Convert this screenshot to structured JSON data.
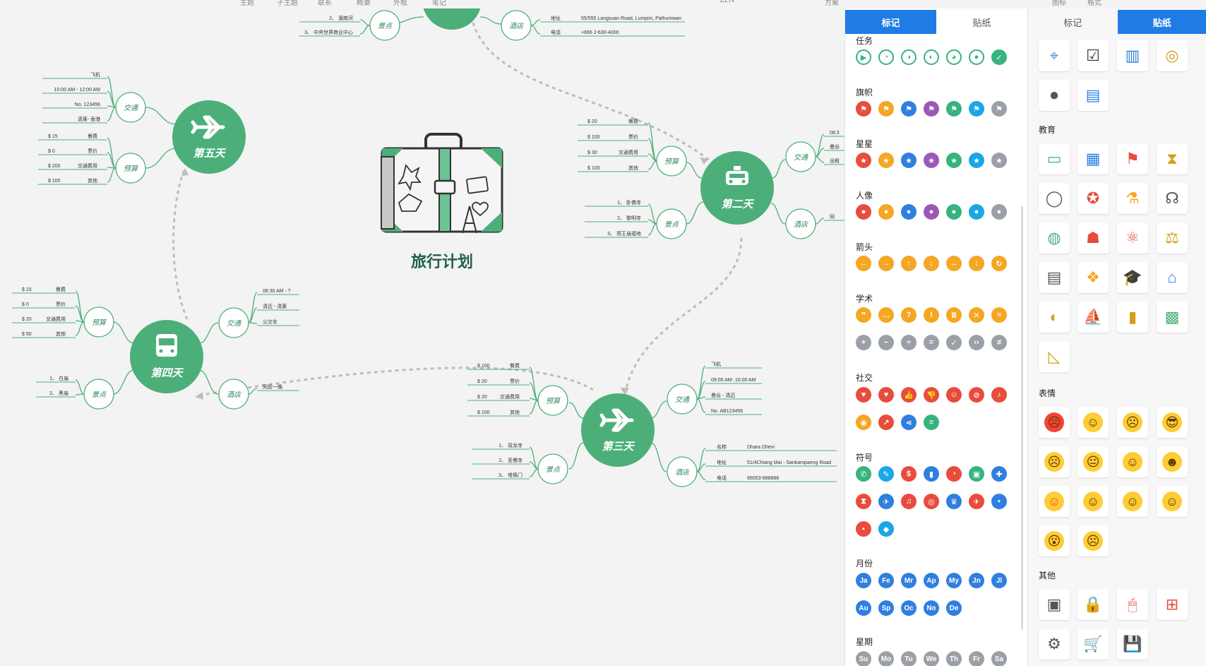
{
  "top_menu": [
    "主题",
    "子主题",
    "联系",
    "概要",
    "外框",
    "笔记",
    "方案",
    "ZEN",
    "图标",
    "格式"
  ],
  "mindmap": {
    "center_title": "旅行计划",
    "days": [
      {
        "label": "第二天",
        "icon": "taxi-icon"
      },
      {
        "label": "第三天",
        "icon": "airplane-icon"
      },
      {
        "label": "第四天",
        "icon": "bus-icon"
      },
      {
        "label": "第五天",
        "icon": "airplane-icon"
      }
    ],
    "subtopics": {
      "transport": "交通",
      "budget": "预算",
      "sights": "景点",
      "hotel": "酒店"
    },
    "top_fragment": {
      "sights": [
        "2、 湄南河",
        "3、 中央世界商业中心"
      ],
      "hotel_fields": [
        [
          "地址",
          "55/555 Langsuan Road, Lumpini, Pathumwan"
        ],
        [
          "电话",
          "+666 2-630-4000"
        ]
      ]
    },
    "day2": {
      "budget": [
        [
          "$ 20",
          "餐费"
        ],
        [
          "$ 100",
          "票价"
        ],
        [
          "$ 30",
          "交通费用"
        ],
        [
          "$ 100",
          "其他"
        ]
      ],
      "sights": [
        "1、 卧佛寺",
        "2、 黎明寺",
        "3、 郑王庙福地"
      ],
      "transport": [
        "08:3",
        "曼谷",
        "出租"
      ],
      "hotel": [
        "同"
      ]
    },
    "day3": {
      "budget": [
        [
          "$ 100",
          "餐费"
        ],
        [
          "$ 20",
          "票价"
        ],
        [
          "$ 20",
          "交通费用"
        ],
        [
          "$ 100",
          "其他"
        ]
      ],
      "sights": [
        "1、 双龙寺",
        "2、 圣佛寺",
        "3、 塔佩门"
      ],
      "transport": [
        "飞机",
        "09:00 AM- 10:00 AM",
        "曼谷 - 清迈",
        "No. AB123456"
      ],
      "hotel_fields": [
        [
          "名称",
          "Dhara Dhevi"
        ],
        [
          "地址",
          "51/4Chiang Mai - Sankampaeng Road"
        ],
        [
          "电话",
          "66053-888888"
        ]
      ]
    },
    "day4": {
      "budget": [
        [
          "$ 15",
          "餐费"
        ],
        [
          "$ 0",
          "票价"
        ],
        [
          "$ 20",
          "交通费用"
        ],
        [
          "$ 50",
          "其他"
        ]
      ],
      "sights": [
        "1、 白庙",
        "2、 黑庙"
      ],
      "transport": [
        "08:30 AM - ?",
        "清迈 - 清莱",
        "公交车"
      ],
      "hotel": [
        "同前一晚"
      ]
    },
    "day5": {
      "transport": [
        "飞机",
        "10:00 AM - 12:00 AM",
        "No. 123456",
        "清莱- 香港"
      ],
      "budget": [
        [
          "$ 15",
          "餐费"
        ],
        [
          "$ 0",
          "票价"
        ],
        [
          "$ 200",
          "交通费用"
        ],
        [
          "$ 100",
          "其他"
        ]
      ]
    }
  },
  "panel": {
    "tabs_a": [
      "标记",
      "贴纸"
    ],
    "tabs_b": [
      "标记",
      "贴纸"
    ],
    "sections_a": {
      "task": "任务",
      "flag": "旗帜",
      "star": "星星",
      "people": "人像",
      "arrow": "箭头",
      "academic": "学术",
      "social": "社交",
      "symbol": "符号",
      "month": "月份",
      "week": "星期"
    },
    "months": [
      "Ja",
      "Fe",
      "Mr",
      "Ap",
      "My",
      "Jn",
      "Jl",
      "Au",
      "Sp",
      "Oc",
      "No",
      "De"
    ],
    "weekdays": [
      "Su",
      "Mo",
      "Tu",
      "We",
      "Th",
      "Fr",
      "Sa"
    ],
    "sections_b": {
      "education": "教育",
      "emotion": "表情",
      "other": "其他"
    },
    "colors": {
      "red": "#e84c3d",
      "orange": "#f5a623",
      "blue": "#2f7fe0",
      "purple": "#9b59b6",
      "green": "#36b37e",
      "cyan": "#1aa7e8",
      "gray": "#9aa0a6",
      "accent": "#1e7ce4",
      "mind": "#4caf7a"
    }
  }
}
